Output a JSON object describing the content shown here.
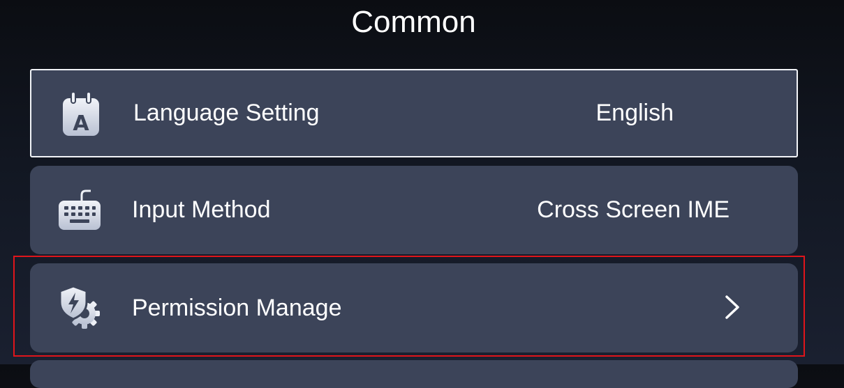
{
  "page": {
    "title": "Common"
  },
  "items": [
    {
      "id": "language",
      "icon": "language-calendar-icon",
      "label": "Language Setting",
      "value": "English"
    },
    {
      "id": "input-method",
      "icon": "keyboard-icon",
      "label": "Input Method",
      "value": "Cross Screen IME"
    },
    {
      "id": "permission",
      "icon": "shield-gear-icon",
      "label": "Permission Manage",
      "value": ""
    }
  ],
  "colors": {
    "card": "#3c4459",
    "focus_border": "#f2f4f8",
    "highlight": "#e0151b"
  }
}
